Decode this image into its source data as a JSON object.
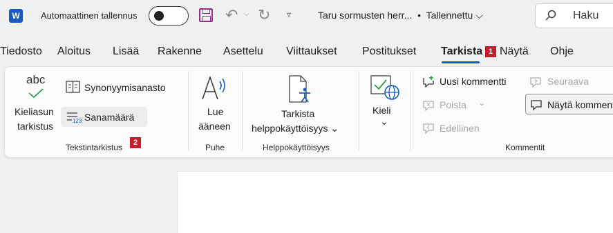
{
  "titlebar": {
    "app_icon": "word-icon",
    "app_icon_letter": "W",
    "autosave_label": "Automaattinen tallennus",
    "autosave_on": false,
    "doc_name": "Taru sormusten herr...",
    "bullet": "•",
    "save_status": "Tallennettu",
    "status_chevron": "⌵",
    "search_placeholder": "Haku"
  },
  "tabs": [
    {
      "label": "Tiedosto"
    },
    {
      "label": "Aloitus"
    },
    {
      "label": "Lisää"
    },
    {
      "label": "Rakenne"
    },
    {
      "label": "Asettelu"
    },
    {
      "label": "Viittaukset"
    },
    {
      "label": "Postitukset"
    },
    {
      "label": "Tarkista",
      "active": true
    },
    {
      "label": "Näytä"
    },
    {
      "label": "Ohje"
    }
  ],
  "badges": {
    "one": "1",
    "two": "2"
  },
  "ribbon": {
    "proofing": {
      "spelling_icon_text": "abc",
      "spelling_line1": "Kieliasun",
      "spelling_line2": "tarkistus",
      "thesaurus": "Synonyymisanasto",
      "wordcount": "Sanamäärä",
      "group_label": "Tekstintarkistus"
    },
    "speech": {
      "read_line1": "Lue",
      "read_line2": "ääneen",
      "group_label": "Puhe"
    },
    "accessibility": {
      "check_line1": "Tarkista",
      "check_line2": "helppokäyttöisyys",
      "group_label": "Helppokäyttöisyys"
    },
    "language": {
      "label": "Kieli",
      "caret": "⌄"
    },
    "comments": {
      "new": "Uusi kommentti",
      "delete": "Poista",
      "previous": "Edellinen",
      "next": "Seuraava",
      "show": "Näytä kommentit",
      "group_label": "Kommentit"
    }
  },
  "colors": {
    "accent": "#185abd",
    "badge": "#c41e2b",
    "save": "#9b2c8c"
  }
}
